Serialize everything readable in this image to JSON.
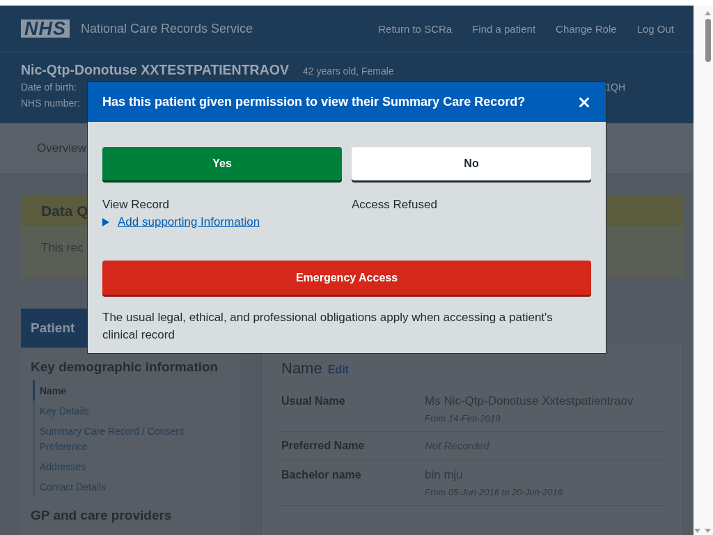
{
  "header": {
    "logo": "NHS",
    "service_name": "National Care Records Service",
    "nav_links": [
      "Return to SCRa",
      "Find a patient",
      "Change Role",
      "Log Out"
    ]
  },
  "patient_banner": {
    "name": "Nic-Qtp-Donotuse XXTESTPATIENTRAOV",
    "age_sex": "42 years old, Female",
    "date_of_birth_label": "Date of birth:",
    "postcode_fragment": "1QH",
    "nhs_number_label": "NHS number:"
  },
  "tabs": [
    "Overview"
  ],
  "data_quality_panel": {
    "title": "Data Q",
    "text": "This rec"
  },
  "sidebar": {
    "title": "Patient",
    "sections": [
      {
        "heading": "Key demographic information",
        "items": [
          {
            "label": "Name",
            "selected": true
          },
          {
            "label": "Key Details",
            "selected": false
          },
          {
            "label": "Summary Care Record / Consent Preference",
            "selected": false
          },
          {
            "label": "Addresses",
            "selected": false
          },
          {
            "label": "Contact Details",
            "selected": false
          }
        ]
      },
      {
        "heading": "GP and care providers"
      }
    ]
  },
  "name_section": {
    "title": "Name",
    "edit_link": "Edit",
    "rows": [
      {
        "label": "Usual Name",
        "value": "Ms Nic-Qtp-Donotuse Xxtestpatientraov",
        "recorded": true,
        "note": "From 14-Feb-2019"
      },
      {
        "label": "Preferred Name",
        "value": "Not Recorded",
        "recorded": false
      },
      {
        "label": "Bachelor name",
        "value": "bin mju",
        "recorded": true,
        "note": "From 05-Jun-2016 to 20-Jun-2016"
      }
    ]
  },
  "modal": {
    "title": "Has this patient given permission to view their Summary Care Record?",
    "options": [
      {
        "kind": "yes",
        "button": "Yes",
        "caption": "View Record",
        "link": "Add supporting Information"
      },
      {
        "kind": "no",
        "button": "No",
        "caption": "Access Refused"
      }
    ],
    "emergency_button": "Emergency Access",
    "footnote": "The usual legal, ethical, and professional obligations apply when accessing a patient's clinical record"
  }
}
